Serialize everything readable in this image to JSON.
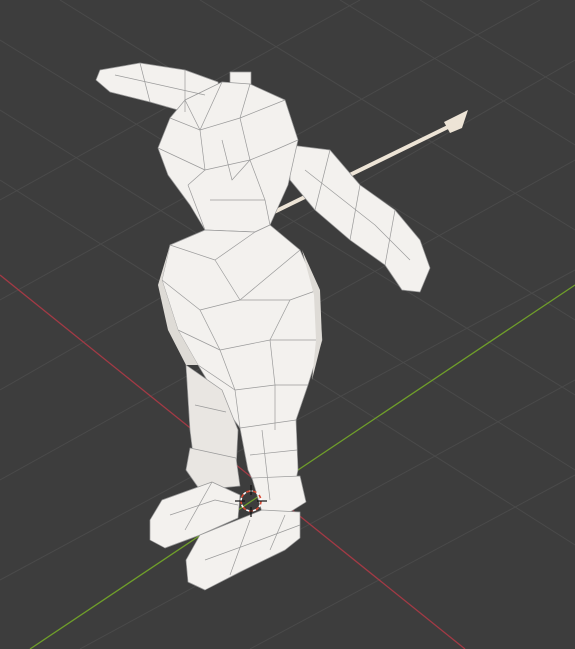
{
  "viewport": {
    "background": "#3d3d3d",
    "grid_color": "#4a4a4a",
    "x_axis_color": "#a23a45",
    "y_axis_color": "#6f9e2a",
    "mesh_fill": "#f3f1ee",
    "mesh_shade": "#dedbd6",
    "wire_color": "#9a9a9a",
    "bone_color": "#ede4d6",
    "cursor_colors": [
      "#d84a34",
      "#ffffff"
    ]
  },
  "scene": {
    "object": "humanoid-mesh",
    "mode": "edit-wireframe-overlay",
    "has_armature_bone": true,
    "has_3d_cursor": true
  },
  "icons": {
    "cursor": "3d-cursor-icon",
    "bone": "bone-icon"
  }
}
